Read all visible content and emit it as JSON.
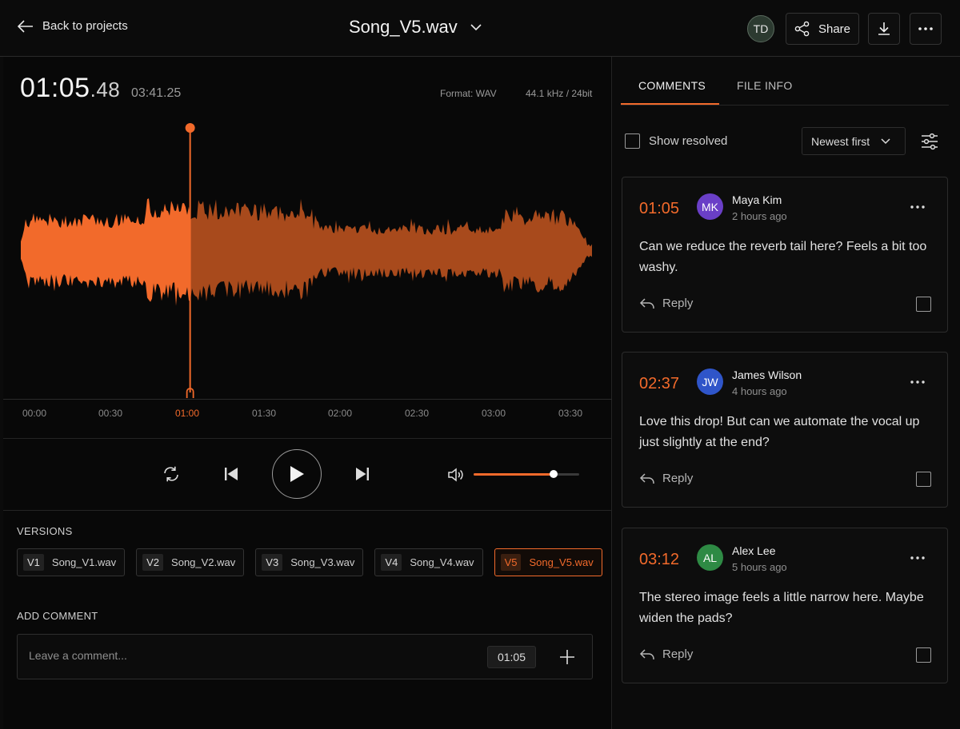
{
  "header": {
    "back_label": "Back to projects",
    "file_title": "Song_V5.wav",
    "user_initials": "TD",
    "share_label": "Share"
  },
  "player": {
    "current_time_main": "01:05",
    "current_time_ms": ".48",
    "total_time": "03:41.25",
    "format": "Format: WAV",
    "sample_rate": "44.1 kHz / 24bit",
    "playhead_fraction": 0.296,
    "volume_fraction": 0.76,
    "accent_color": "#f26a2b",
    "timeline": [
      "00:00",
      "00:30",
      "01:00",
      "01:30",
      "02:00",
      "02:30",
      "03:00",
      "03:30"
    ],
    "active_tick": "01:00"
  },
  "versions": {
    "label": "VERSIONS",
    "items": [
      {
        "tag": "V1",
        "name": "Song_V1.wav",
        "active": false
      },
      {
        "tag": "V2",
        "name": "Song_V2.wav",
        "active": false
      },
      {
        "tag": "V3",
        "name": "Song_V3.wav",
        "active": false
      },
      {
        "tag": "V4",
        "name": "Song_V4.wav",
        "active": false
      },
      {
        "tag": "V5",
        "name": "Song_V5.wav",
        "active": true
      }
    ]
  },
  "add_comment": {
    "label": "ADD COMMENT",
    "placeholder": "Leave a comment...",
    "timestamp": "01:05"
  },
  "sidebar": {
    "tabs": [
      {
        "label": "COMMENTS",
        "active": true
      },
      {
        "label": "FILE INFO",
        "active": false
      }
    ],
    "show_resolved_label": "Show resolved",
    "sort_label": "Newest first",
    "reply_label": "Reply",
    "comments": [
      {
        "time": "01:05",
        "initials": "MK",
        "avatar_color": "#6a3fc7",
        "name": "Maya Kim",
        "ago": "2 hours ago",
        "text": "Can we reduce the reverb tail here? Feels a bit too washy."
      },
      {
        "time": "02:37",
        "initials": "JW",
        "avatar_color": "#2f55c9",
        "name": "James Wilson",
        "ago": "4 hours ago",
        "text": "Love this drop! But can we automate the vocal up just slightly at the end?"
      },
      {
        "time": "03:12",
        "initials": "AL",
        "avatar_color": "#2e8a44",
        "name": "Alex Lee",
        "ago": "5 hours ago",
        "text": "The stereo image feels a little narrow here. Maybe widen the pads?"
      }
    ]
  },
  "icons": {
    "back": "arrow-left-icon",
    "dropdown": "chevron-down-icon",
    "share": "share-icon",
    "download": "download-icon",
    "more": "more-horizontal-icon",
    "loop": "loop-icon",
    "prev": "skip-back-icon",
    "play": "play-icon",
    "next": "skip-forward-icon",
    "volume": "volume-icon",
    "add": "plus-icon",
    "filter": "sliders-icon",
    "reply": "reply-icon"
  }
}
